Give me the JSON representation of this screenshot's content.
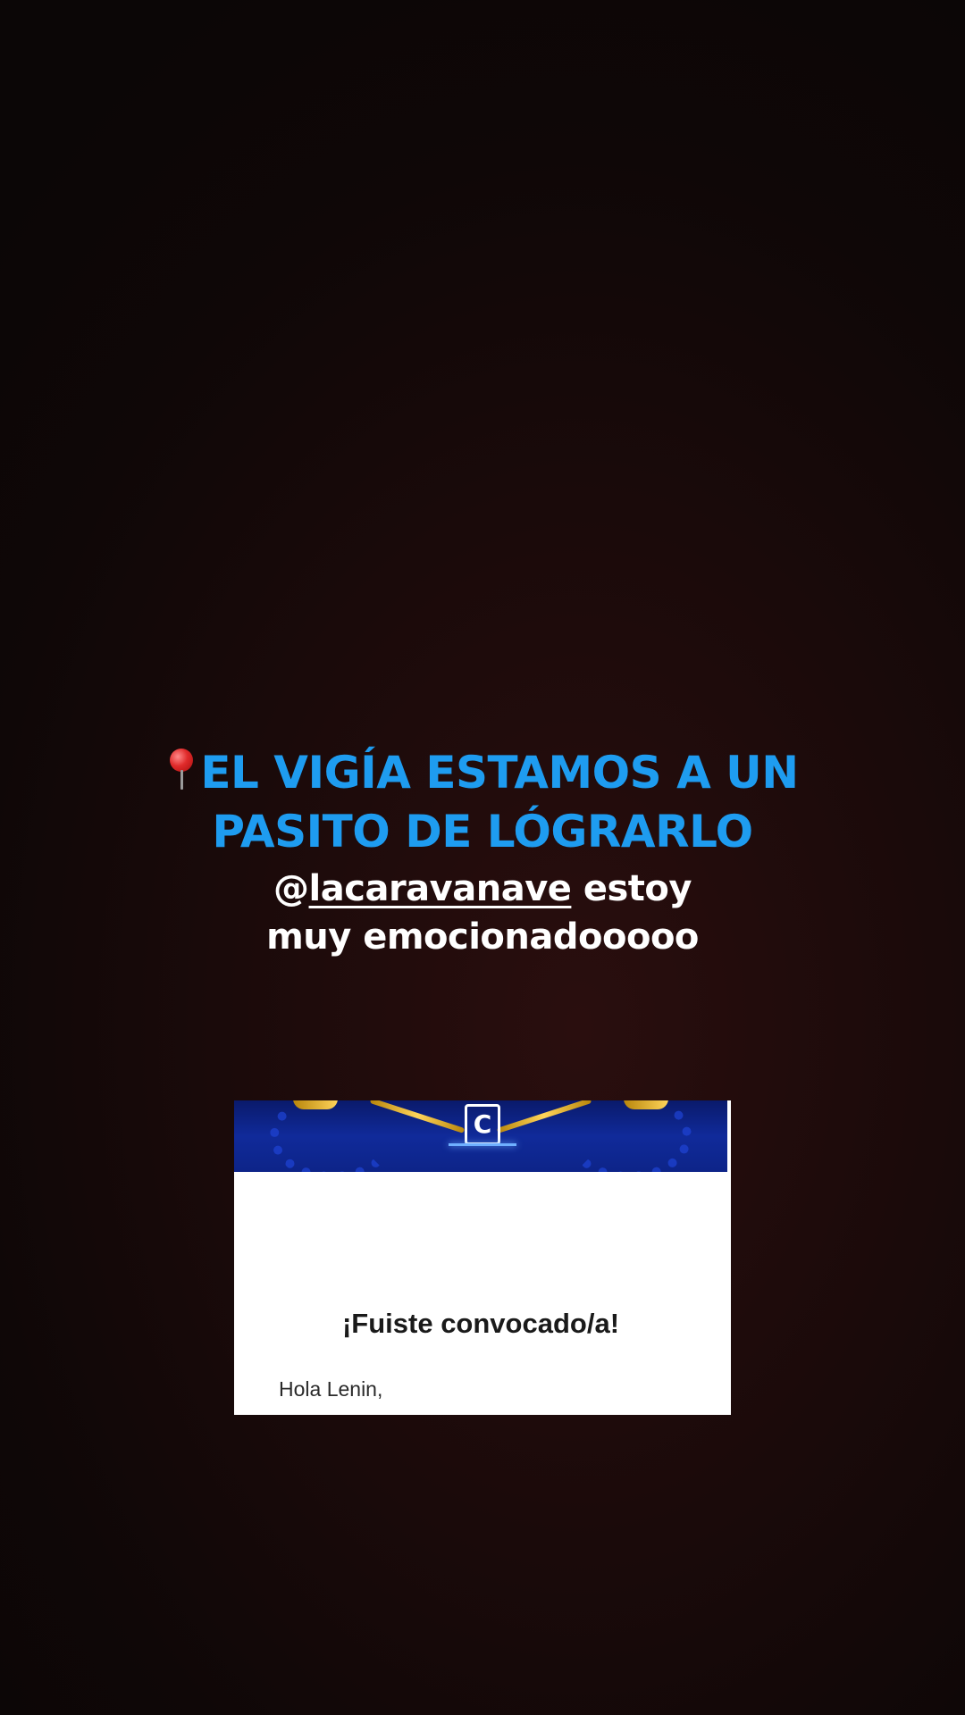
{
  "caption": {
    "headline_line1": "EL VIGÍA ESTAMOS A UN",
    "headline_line2": "PASITO DE LÓGRARLO",
    "mention": "lacaravanave",
    "text_after_mention": " estoy",
    "line2": "muy emocionadooooo",
    "headline_color": "#1e9cf0",
    "pin_icon": "round-pushpin-icon",
    "threads_icon": "threads-icon"
  },
  "card": {
    "logo_letter": "C",
    "title": "¡Fuiste convocado/a!",
    "greeting": "Hola Lenin,"
  }
}
